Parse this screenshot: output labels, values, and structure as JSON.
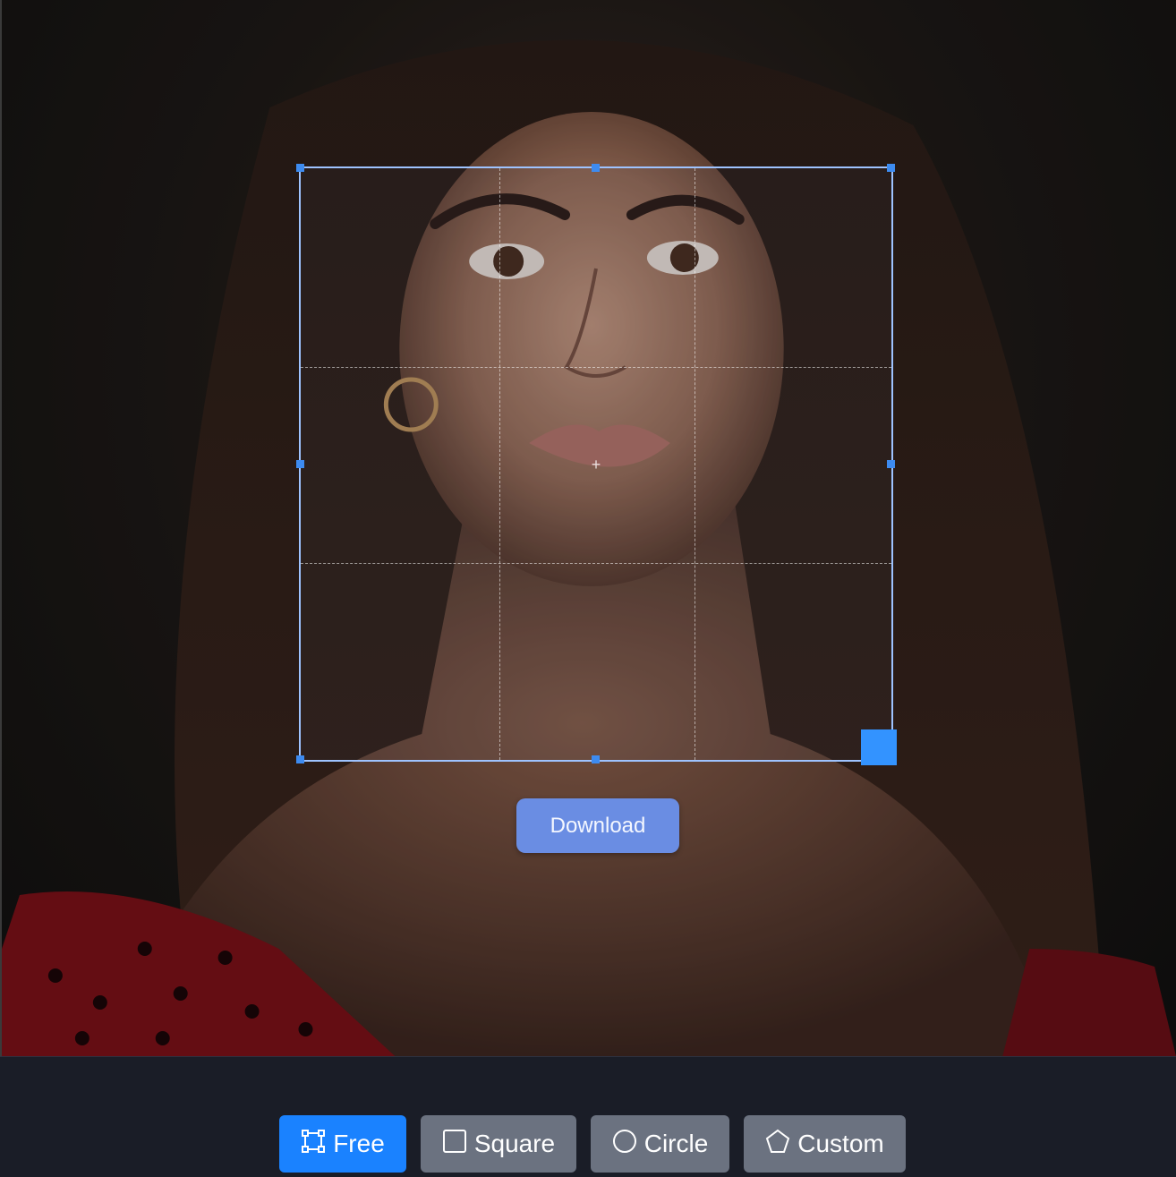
{
  "editor": {
    "download_label": "Download",
    "accent_color": "#3393ff",
    "crop_frame_color": "#9ec3ff"
  },
  "toolbar": {
    "modes": [
      {
        "label": "Free",
        "icon": "free-transform-icon",
        "active": true
      },
      {
        "label": "Square",
        "icon": "square-icon",
        "active": false
      },
      {
        "label": "Circle",
        "icon": "circle-icon",
        "active": false
      },
      {
        "label": "Custom",
        "icon": "pentagon-icon",
        "active": false
      }
    ],
    "active_color": "#1a82ff",
    "inactive_color": "#6b7280"
  }
}
